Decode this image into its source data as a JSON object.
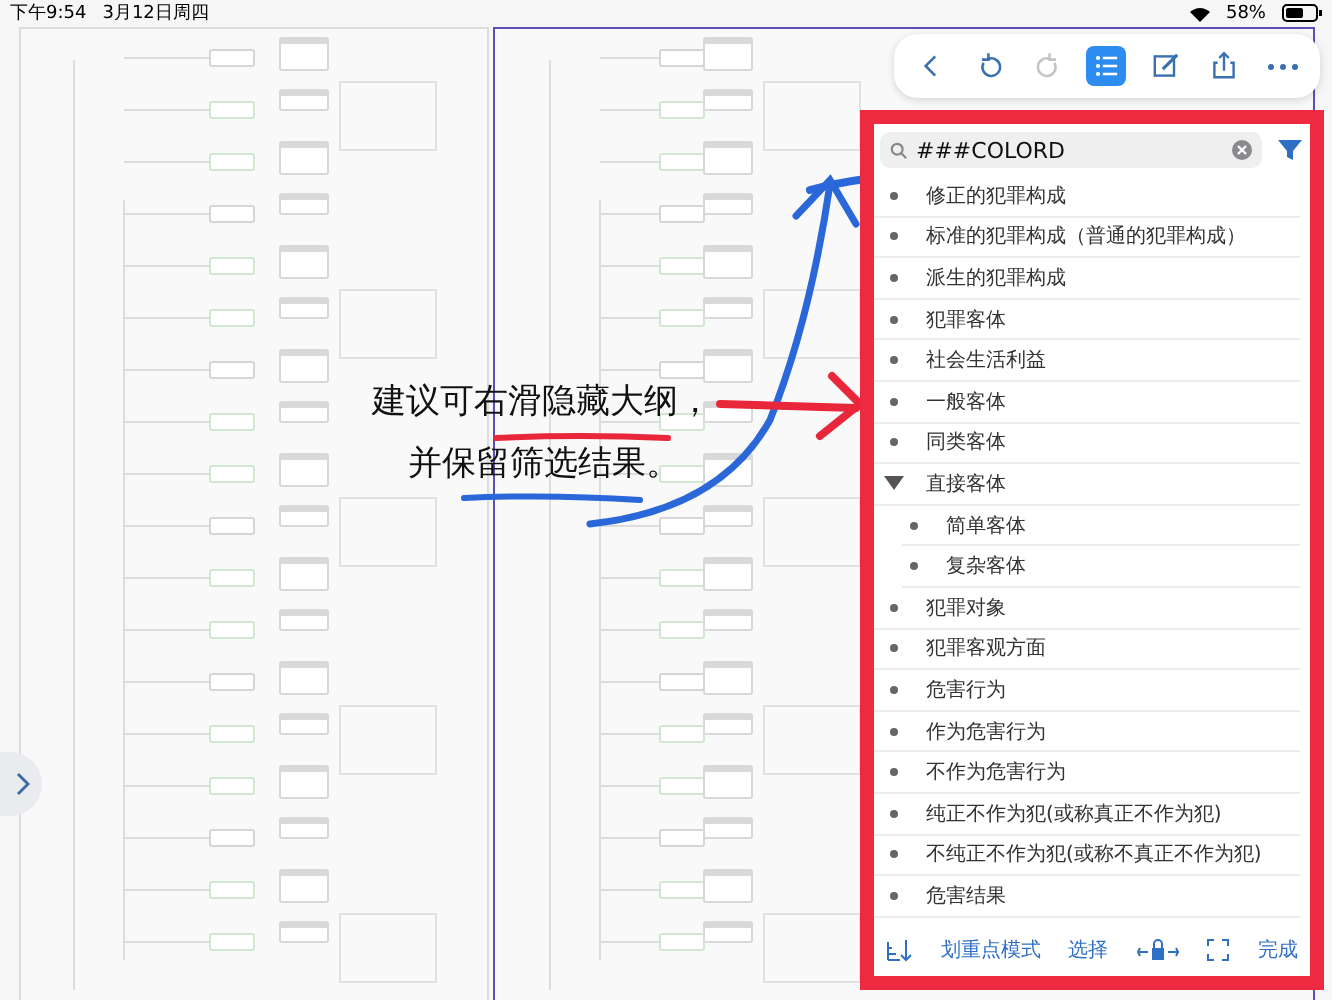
{
  "status_bar": {
    "time": "下午9:54",
    "date": "3月12日周四",
    "battery": "58%"
  },
  "toolbar": [
    {
      "kind": "back",
      "selected": false,
      "disabled": false
    },
    {
      "kind": "undo",
      "selected": false,
      "disabled": false
    },
    {
      "kind": "redo",
      "selected": false,
      "disabled": true
    },
    {
      "kind": "outline",
      "selected": true,
      "disabled": false
    },
    {
      "kind": "edit",
      "selected": false,
      "disabled": false
    },
    {
      "kind": "share",
      "selected": false,
      "disabled": false
    },
    {
      "kind": "more",
      "selected": false,
      "disabled": false
    }
  ],
  "outline": {
    "search": {
      "value": "###COLORD"
    },
    "items": [
      {
        "text": "修正的犯罪构成"
      },
      {
        "text": "标准的犯罪构成（普通的犯罪构成）"
      },
      {
        "text": "派生的犯罪构成"
      },
      {
        "text": "犯罪客体"
      },
      {
        "text": "社会生活利益"
      },
      {
        "text": "一般客体"
      },
      {
        "text": "同类客体"
      },
      {
        "text": "直接客体",
        "expanded": true,
        "children": [
          {
            "text": "简单客体"
          },
          {
            "text": "复杂客体"
          }
        ]
      },
      {
        "text": "犯罪对象"
      },
      {
        "text": "犯罪客观方面"
      },
      {
        "text": "危害行为"
      },
      {
        "text": "作为危害行为"
      },
      {
        "text": "不作为危害行为"
      },
      {
        "text": "纯正不作为犯(或称真正不作为犯)"
      },
      {
        "text": "不纯正不作为犯(或称不真正不作为犯)"
      },
      {
        "text": "危害结果"
      }
    ]
  },
  "bottom_bar": [
    {
      "kind": "sort"
    },
    {
      "kind": "text",
      "label": "划重点模式"
    },
    {
      "kind": "text",
      "label": "选择"
    },
    {
      "kind": "lock"
    },
    {
      "kind": "fit"
    },
    {
      "kind": "text",
      "label": "完成"
    }
  ],
  "annotation": {
    "lines": [
      "建议可右滑隐藏大纲，",
      "并保留筛选结果。"
    ]
  }
}
